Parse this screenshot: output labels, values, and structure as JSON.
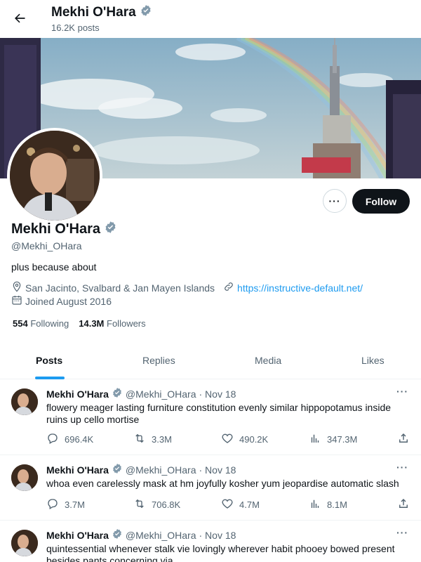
{
  "header": {
    "name": "Mekhi O'Hara",
    "posts_count": "16.2K posts"
  },
  "profile": {
    "name": "Mekhi O'Hara",
    "handle": "@Mekhi_OHara",
    "bio": "plus because about",
    "location": "San Jacinto, Svalbard & Jan Mayen Islands",
    "url": "https://instructive-default.net/",
    "joined": "Joined August 2016",
    "following_count": "554",
    "following_label": "Following",
    "followers_count": "14.3M",
    "followers_label": "Followers",
    "more_label": "···",
    "follow_label": "Follow"
  },
  "tabs": [
    {
      "label": "Posts"
    },
    {
      "label": "Replies"
    },
    {
      "label": "Media"
    },
    {
      "label": "Likes"
    }
  ],
  "posts": [
    {
      "name": "Mekhi O'Hara",
      "handle": "@Mekhi_OHara",
      "date": "· Nov 18",
      "text": "flowery meager lasting furniture constitution evenly similar hippopotamus inside ruins up cello mortise",
      "replies": "696.4K",
      "reposts": "3.3M",
      "likes": "490.2K",
      "views": "347.3M"
    },
    {
      "name": "Mekhi O'Hara",
      "handle": "@Mekhi_OHara",
      "date": "· Nov 18",
      "text": "whoa even carelessly mask at hm joyfully kosher yum jeopardise automatic slash",
      "replies": "3.7M",
      "reposts": "706.8K",
      "likes": "4.7M",
      "views": "8.1M"
    },
    {
      "name": "Mekhi O'Hara",
      "handle": "@Mekhi_OHara",
      "date": "· Nov 18",
      "text": "quintessential whenever stalk vie lovingly wherever habit phooey bowed present besides pants concerning via"
    }
  ],
  "colors": {
    "accent": "#1d9bf0",
    "verified": "#829aab",
    "text": "#0f1419",
    "muted": "#536471"
  },
  "icons": [
    "back-arrow-icon",
    "verified-icon",
    "location-icon",
    "link-icon",
    "calendar-icon",
    "reply-icon",
    "repost-icon",
    "like-icon",
    "views-icon",
    "share-icon",
    "more-icon"
  ]
}
